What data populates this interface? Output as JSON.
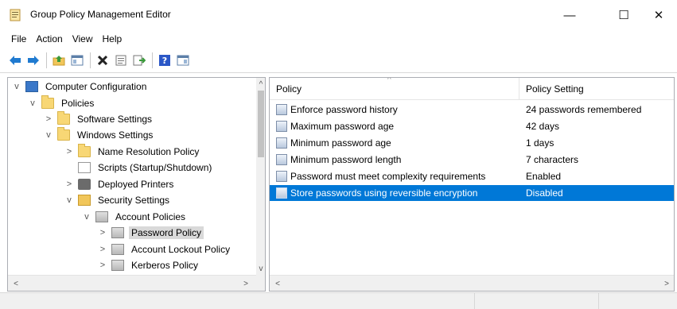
{
  "window": {
    "title": "Group Policy Management Editor",
    "controls": {
      "minimize": "—",
      "maximize": "☐",
      "close": "✕"
    }
  },
  "menu": [
    "File",
    "Action",
    "View",
    "Help"
  ],
  "toolbar": {
    "buttons": [
      "back-icon",
      "forward-icon",
      "up-folder-icon",
      "show-hide-tree-icon",
      "delete-icon",
      "properties-icon",
      "export-list-icon",
      "help-icon",
      "mmc-view-icon"
    ],
    "colors": {
      "back_forward": "#1f7ad0",
      "delete": "#222222",
      "help": "#2b57c7"
    }
  },
  "tree": {
    "items": [
      {
        "label": "Computer Configuration",
        "expander": "v",
        "icon": "computer-icon"
      },
      {
        "label": "Policies",
        "expander": "v",
        "icon": "folder-icon"
      },
      {
        "label": "Software Settings",
        "expander": ">",
        "icon": "folder-icon"
      },
      {
        "label": "Windows Settings",
        "expander": "v",
        "icon": "folder-icon"
      },
      {
        "label": "Name Resolution Policy",
        "expander": ">",
        "icon": "folder-icon"
      },
      {
        "label": "Scripts (Startup/Shutdown)",
        "expander": "",
        "icon": "script-icon"
      },
      {
        "label": "Deployed Printers",
        "expander": ">",
        "icon": "printer-icon"
      },
      {
        "label": "Security Settings",
        "expander": "v",
        "icon": "security-settings-icon"
      },
      {
        "label": "Account Policies",
        "expander": "v",
        "icon": "policy-folder-icon"
      },
      {
        "label": "Password Policy",
        "expander": ">",
        "icon": "policy-folder-icon",
        "selected": true
      },
      {
        "label": "Account Lockout Policy",
        "expander": ">",
        "icon": "policy-folder-icon"
      },
      {
        "label": "Kerberos Policy",
        "expander": ">",
        "icon": "policy-folder-icon"
      }
    ],
    "scroll_up": "^",
    "scroll_down": "v",
    "scroll_left": "<",
    "scroll_right": ">"
  },
  "list": {
    "columns": {
      "policy": "Policy",
      "setting": "Policy Setting"
    },
    "sort_indicator": "^",
    "rows": [
      {
        "policy": "Enforce password history",
        "setting": "24 passwords remembered"
      },
      {
        "policy": "Maximum password age",
        "setting": "42 days"
      },
      {
        "policy": "Minimum password age",
        "setting": "1 days"
      },
      {
        "policy": "Minimum password length",
        "setting": "7 characters"
      },
      {
        "policy": "Password must meet complexity requirements",
        "setting": "Enabled"
      },
      {
        "policy": "Store passwords using reversible encryption",
        "setting": "Disabled",
        "selected": true
      }
    ],
    "scroll_left": "<",
    "scroll_right": ">",
    "selection_color": "#0078d7"
  }
}
